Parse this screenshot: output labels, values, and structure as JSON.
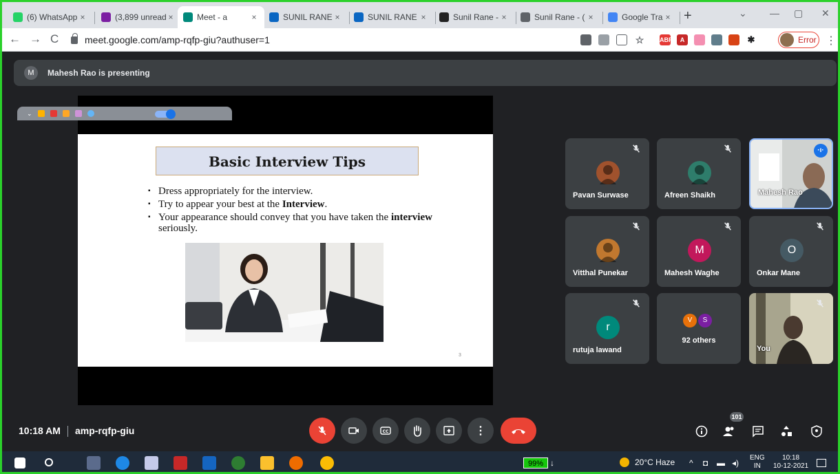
{
  "browser": {
    "tabs": [
      {
        "label": "(6) WhatsApp",
        "icon": "whatsapp-icon",
        "color": "#25d366"
      },
      {
        "label": "(3,899 unread)",
        "icon": "mail-icon",
        "color": "#7b1fa2"
      },
      {
        "label": "Meet - a",
        "icon": "meet-icon",
        "color": "#00897b",
        "active": true
      },
      {
        "label": "SUNIL RANE",
        "icon": "linkedin-icon",
        "color": "#0a66c2"
      },
      {
        "label": "SUNIL RANE",
        "icon": "linkedin-icon",
        "color": "#0a66c2"
      },
      {
        "label": "Sunil Rane - \\",
        "icon": "zoho-icon",
        "color": "#222222"
      },
      {
        "label": "Sunil Rane - (",
        "icon": "globe-icon",
        "color": "#5f6368"
      },
      {
        "label": "Google Trans",
        "icon": "translate-icon",
        "color": "#4285f4"
      }
    ],
    "url": "meet.google.com/amp-rqfp-giu?authuser=1",
    "profile_label": "Error"
  },
  "meet": {
    "presenting_initial": "M",
    "presenting_text": "Mahesh Rao is presenting",
    "slide": {
      "title": "Basic Interview Tips",
      "bullets": [
        {
          "pre": "Dress appropriately for the interview.",
          "bold": "",
          "post": ""
        },
        {
          "pre": "Try to appear your best at the ",
          "bold": "Interview",
          "post": "."
        },
        {
          "pre": "Your appearance should convey that you have taken the ",
          "bold": "interview",
          "post": " seriously."
        }
      ],
      "page_number": "3"
    },
    "participants": [
      {
        "name": "Pavan Surwase",
        "type": "photo",
        "color": "#a0522d",
        "muted": true
      },
      {
        "name": "Afreen Shaikh",
        "type": "photo",
        "color": "#2e7d6b",
        "muted": true
      },
      {
        "name": "Mahesh Rao",
        "type": "video",
        "speaking": true
      },
      {
        "name": "Vitthal Punekar",
        "type": "photo",
        "color": "#c1782f",
        "muted": true
      },
      {
        "name": "Mahesh Waghe",
        "type": "initial",
        "initial": "M",
        "color": "#c2185b",
        "muted": true
      },
      {
        "name": "Onkar Mane",
        "type": "initial",
        "initial": "O",
        "color": "#455a64",
        "muted": true
      },
      {
        "name": "rutuja lawand",
        "type": "initial",
        "initial": "r",
        "color": "#00897b",
        "muted": true
      },
      {
        "name": "92 others",
        "type": "others",
        "initials": [
          "V",
          "S"
        ],
        "colors": [
          "#e8710a",
          "#7b1fa2"
        ]
      },
      {
        "name": "You",
        "type": "video",
        "muted": true
      }
    ],
    "time": "10:18 AM",
    "meeting_code": "amp-rqfp-giu",
    "participant_count": "101"
  },
  "taskbar": {
    "battery": "99%",
    "weather": "20°C  Haze",
    "lang_top": "ENG",
    "lang_bottom": "IN",
    "clock_time": "10:18",
    "clock_date": "10-12-2021"
  }
}
